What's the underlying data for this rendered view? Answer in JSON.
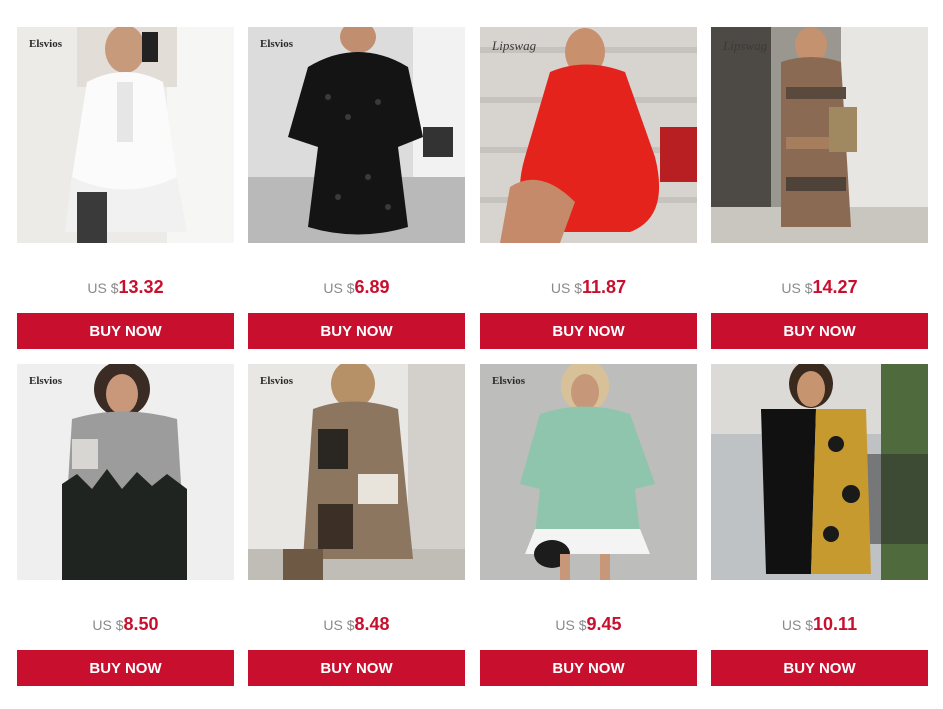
{
  "currency_label": "US $",
  "accent_color": "#c8102e",
  "products": [
    {
      "brand": "Elsvios",
      "price": "13.32",
      "button": "BUY NOW",
      "dress": "white ruffle dress"
    },
    {
      "brand": "Elsvios",
      "price": "6.89",
      "button": "BUY NOW",
      "dress": "black polka dot mesh dress"
    },
    {
      "brand": "Lipswag",
      "price": "11.87",
      "button": "BUY NOW",
      "dress": "red ruffle shirt dress"
    },
    {
      "brand": "Lipswag",
      "price": "14.27",
      "button": "BUY NOW",
      "dress": "plaid maxi shirt dress"
    },
    {
      "brand": "Elsvios",
      "price": "8.50",
      "button": "BUY NOW",
      "dress": "grey tree print sweater dress"
    },
    {
      "brand": "Elsvios",
      "price": "8.48",
      "button": "BUY NOW",
      "dress": "leopard patchwork dress"
    },
    {
      "brand": "Elsvios",
      "price": "9.45",
      "button": "BUY NOW",
      "dress": "mint sweatshirt ruffle dress"
    },
    {
      "brand": "",
      "price": "10.11",
      "button": "BUY NOW",
      "dress": "black chain print blazer dress"
    }
  ]
}
